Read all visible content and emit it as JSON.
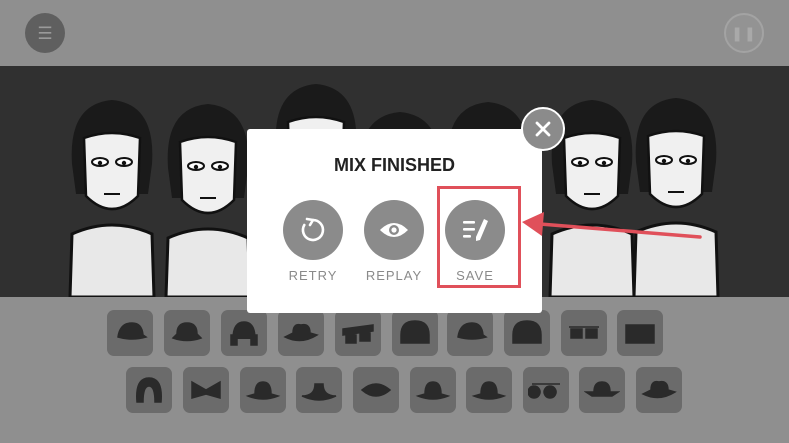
{
  "topbar": {
    "menu_icon": "menu-icon",
    "menu_glyph": "☰",
    "pause_icon": "pause-icon",
    "pause_glyph": "❚❚"
  },
  "stage": {
    "character_count": 8,
    "background": "#303030"
  },
  "dialog": {
    "title": "MIX FINISHED",
    "actions": [
      {
        "label": "RETRY",
        "icon": "retry-icon"
      },
      {
        "label": "REPLAY",
        "icon": "eye-icon"
      },
      {
        "label": "SAVE",
        "icon": "save-edit-icon"
      }
    ],
    "close_icon": "close-icon"
  },
  "tray": {
    "row1_icons": [
      "cap-icon",
      "bowler-hat-icon",
      "headphones-icon",
      "fedora-icon",
      "glasses-icon",
      "helmet-icon",
      "cap-icon",
      "helmet-icon",
      "sunglasses-icon",
      "speaker-icon"
    ],
    "row2_icons": [
      "hood-icon",
      "bowtie-icon",
      "hat-icon",
      "sombrero-icon",
      "headband-icon",
      "hat-icon",
      "hat-icon",
      "goggles-icon",
      "wide-brim-hat-icon",
      "fedora-icon"
    ]
  },
  "annotation": {
    "highlight_color": "#e0505a"
  }
}
